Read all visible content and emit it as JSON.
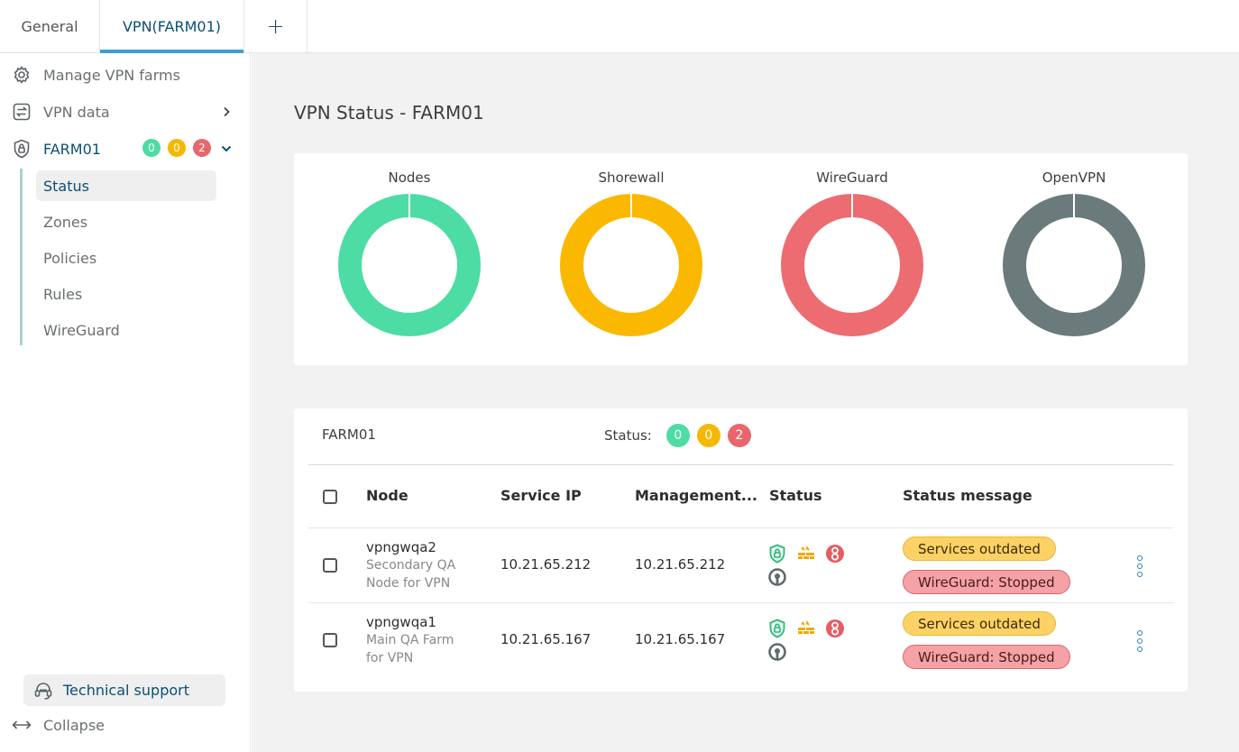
{
  "tabs": {
    "general": "General",
    "vpn": "VPN(FARM01)",
    "add": "+"
  },
  "sidebar": {
    "manage": "Manage VPN farms",
    "vpn_data": "VPN data",
    "farm": "FARM01",
    "farm_badges": [
      "0",
      "0",
      "2"
    ],
    "sub_items": [
      "Status",
      "Zones",
      "Policies",
      "Rules",
      "WireGuard"
    ],
    "support": "Technical support",
    "collapse": "Collapse"
  },
  "main": {
    "title": "VPN Status - FARM01",
    "donuts": [
      {
        "label": "Nodes",
        "color": "#4cdca4"
      },
      {
        "label": "Shorewall",
        "color": "#fbb800"
      },
      {
        "label": "WireGuard",
        "color": "#ec6c72"
      },
      {
        "label": "OpenVPN",
        "color": "#6b7b7c"
      }
    ],
    "table": {
      "farm": "FARM01",
      "status_label": "Status:",
      "status_badges": [
        "0",
        "0",
        "2"
      ],
      "headers": [
        "Node",
        "Service IP",
        "Management...",
        "Status",
        "Status message"
      ],
      "rows": [
        {
          "node": "vpngwqa2",
          "desc": [
            "Secondary QA",
            "Node for VPN"
          ],
          "service_ip": "10.21.65.212",
          "mgmt_ip": "10.21.65.212",
          "messages": [
            "Services outdated",
            "WireGuard: Stopped"
          ]
        },
        {
          "node": "vpngwqa1",
          "desc": [
            "Main QA Farm",
            "for VPN"
          ],
          "service_ip": "10.21.65.167",
          "mgmt_ip": "10.21.65.167",
          "messages": [
            "Services outdated",
            "WireGuard: Stopped"
          ]
        }
      ]
    }
  }
}
